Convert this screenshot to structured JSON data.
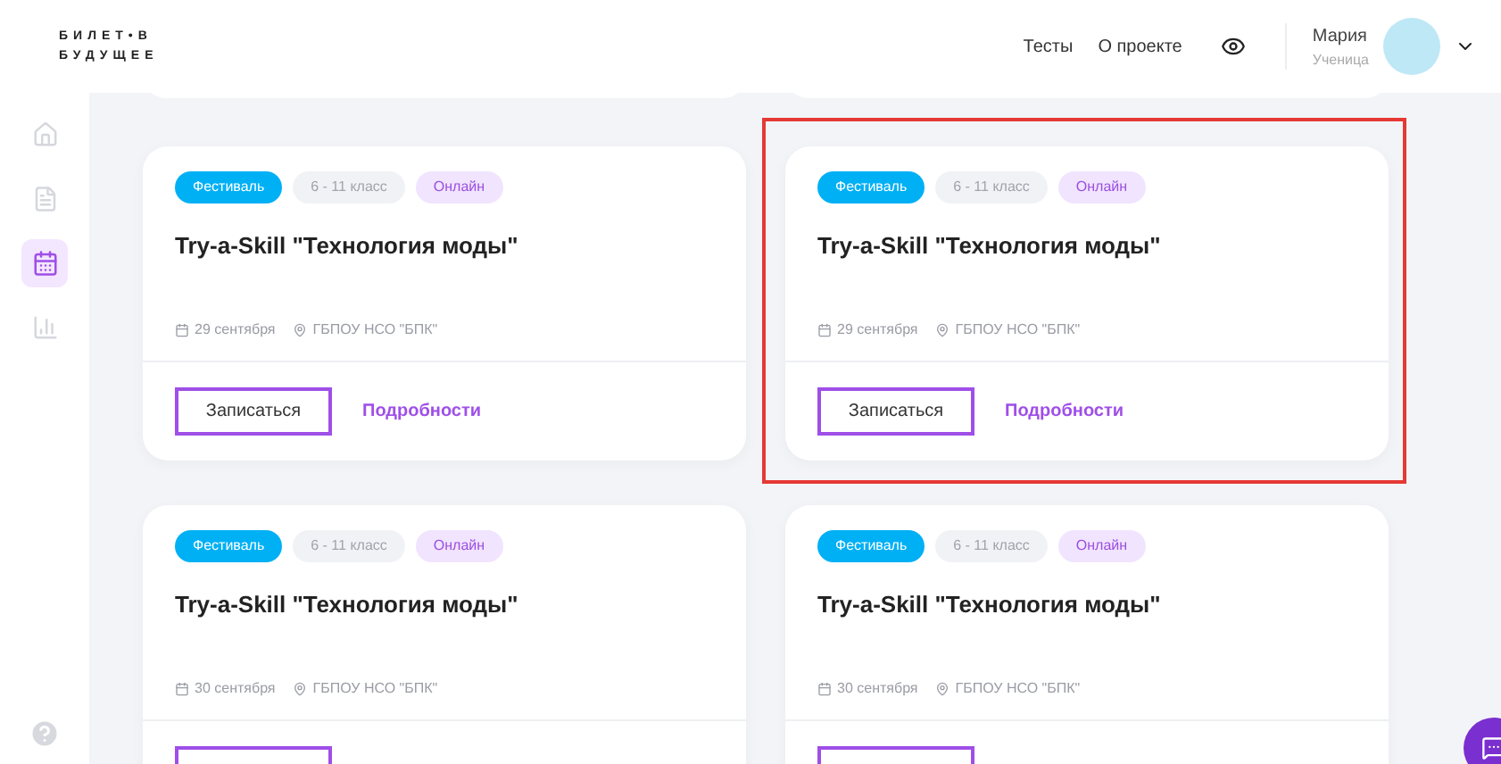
{
  "logo": {
    "line_1": "БИЛЕТ•В",
    "line_2": "БУДУЩЕЕ"
  },
  "nav": [
    "Тесты",
    "О проекте"
  ],
  "user": {
    "name": "Мария",
    "role": "Ученица"
  },
  "sidebar": {
    "items": [
      {
        "kind": "home",
        "selected": false
      },
      {
        "kind": "list",
        "selected": false
      },
      {
        "kind": "calendar",
        "selected": true
      },
      {
        "kind": "chart",
        "selected": false
      }
    ]
  },
  "cards": [
    {
      "tags": [
        {
          "kind": "type",
          "text": "Фестиваль"
        },
        {
          "kind": "grade",
          "text": "6 - 11 класс"
        },
        {
          "kind": "format",
          "text": "Онлайн"
        }
      ],
      "title": "Try-a-Skill \"Технология моды\"",
      "date": "29 сентября",
      "place": "ГБПОУ НСО \"БПК\"",
      "primary": "Записаться",
      "secondary": "Подробности",
      "highlighted": false
    },
    {
      "tags": [
        {
          "kind": "type",
          "text": "Фестиваль"
        },
        {
          "kind": "grade",
          "text": "6 - 11 класс"
        },
        {
          "kind": "format",
          "text": "Онлайн"
        }
      ],
      "title": "Try-a-Skill \"Технология моды\"",
      "date": "29 сентября",
      "place": "ГБПОУ НСО \"БПК\"",
      "primary": "Записаться",
      "secondary": "Подробности",
      "highlighted": true
    },
    {
      "tags": [
        {
          "kind": "type",
          "text": "Фестиваль"
        },
        {
          "kind": "grade",
          "text": "6 - 11 класс"
        },
        {
          "kind": "format",
          "text": "Онлайн"
        }
      ],
      "title": "Try-a-Skill \"Технология моды\"",
      "date": "30 сентября",
      "place": "ГБПОУ НСО \"БПК\"",
      "highlighted": false
    },
    {
      "tags": [
        {
          "kind": "type",
          "text": "Фестиваль"
        },
        {
          "kind": "grade",
          "text": "6 - 11 класс"
        },
        {
          "kind": "format",
          "text": "Онлайн"
        }
      ],
      "title": "Try-a-Skill \"Технология моды\"",
      "date": "30 сентября",
      "place": "ГБПОУ НСО \"БПК\"",
      "highlighted": false
    }
  ]
}
